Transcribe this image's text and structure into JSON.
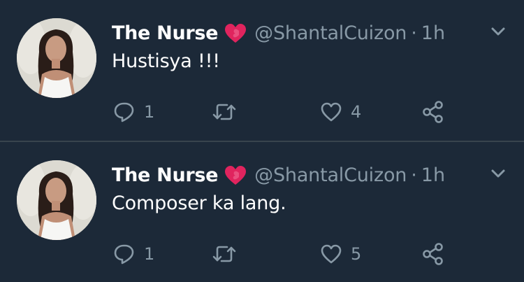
{
  "tweets": [
    {
      "author_name": "The Nurse",
      "author_emoji": "two-hearts-emoji",
      "handle": "@ShantalCuizon",
      "separator": "·",
      "time": "1h",
      "text": "Hustisya !!!",
      "reply_count": "1",
      "retweet_count": "",
      "like_count": "4"
    },
    {
      "author_name": "The Nurse",
      "author_emoji": "two-hearts-emoji",
      "handle": "@ShantalCuizon",
      "separator": "·",
      "time": "1h",
      "text": "Composer ka lang.",
      "reply_count": "1",
      "retweet_count": "",
      "like_count": "5"
    }
  ],
  "icons": {
    "reply": "reply-icon",
    "retweet": "retweet-icon",
    "like": "like-icon",
    "share": "share-icon",
    "menu": "chevron-down-icon"
  },
  "colors": {
    "background": "#1c2938",
    "divider": "#38444d",
    "primary_text": "#ffffff",
    "secondary_text": "#8899a6",
    "emoji_heart": "#e0245e"
  }
}
